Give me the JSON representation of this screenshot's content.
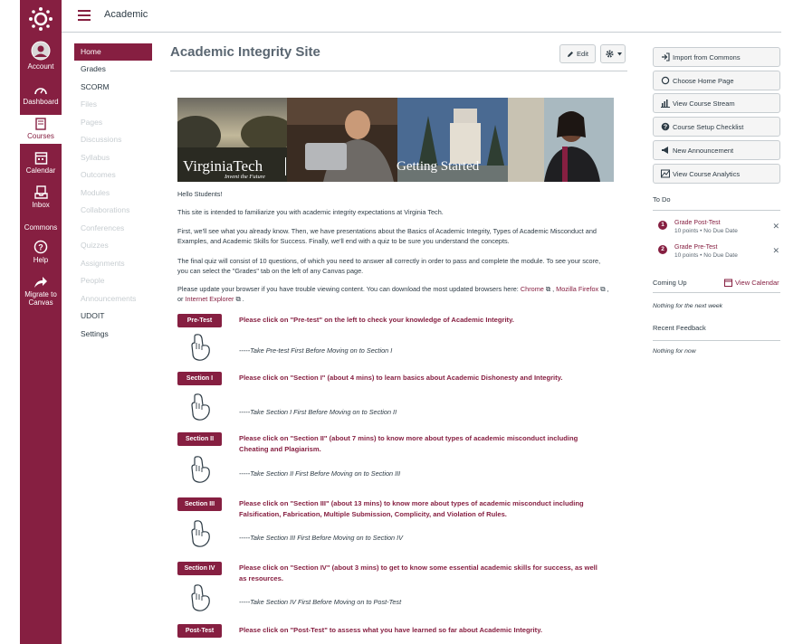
{
  "global_nav": {
    "items": [
      {
        "label": "Account",
        "icon": "account-icon"
      },
      {
        "label": "Dashboard",
        "icon": "dashboard-icon"
      },
      {
        "label": "Courses",
        "icon": "courses-icon"
      },
      {
        "label": "Calendar",
        "icon": "calendar-icon"
      },
      {
        "label": "Inbox",
        "icon": "inbox-icon"
      },
      {
        "label": "Commons",
        "icon": "commons-icon"
      },
      {
        "label": "Help",
        "icon": "help-icon"
      },
      {
        "label": "Migrate to Canvas",
        "icon": "migrate-icon"
      }
    ],
    "brand_color": "#861f41"
  },
  "header": {
    "breadcrumb": "Academic"
  },
  "course_nav": {
    "items": [
      {
        "label": "Home",
        "state": "active"
      },
      {
        "label": "Grades",
        "state": "enabled"
      },
      {
        "label": "SCORM",
        "state": "enabled"
      },
      {
        "label": "Files",
        "state": "disabled"
      },
      {
        "label": "Pages",
        "state": "disabled"
      },
      {
        "label": "Discussions",
        "state": "disabled"
      },
      {
        "label": "Syllabus",
        "state": "disabled"
      },
      {
        "label": "Outcomes",
        "state": "disabled"
      },
      {
        "label": "Modules",
        "state": "disabled"
      },
      {
        "label": "Collaborations",
        "state": "disabled"
      },
      {
        "label": "Conferences",
        "state": "disabled"
      },
      {
        "label": "Quizzes",
        "state": "disabled"
      },
      {
        "label": "Assignments",
        "state": "disabled"
      },
      {
        "label": "People",
        "state": "disabled"
      },
      {
        "label": "Announcements",
        "state": "disabled"
      },
      {
        "label": "UDOIT",
        "state": "enabled"
      },
      {
        "label": "Settings",
        "state": "enabled"
      }
    ]
  },
  "main": {
    "title": "Academic Integrity Site",
    "edit_label": "Edit",
    "banner": {
      "brand": "VirginiaTech",
      "tagline": "Invent the Future",
      "caption": "Getting Started"
    },
    "greeting": "Hello Students!",
    "intro": "This site is intended to familiarize you with academic integrity expectations at Virginia Tech.",
    "plan": "First, we'll see what you already know. Then, we have presentations about the Basics of Academic Integrity, Types of Academic Misconduct and Examples, and Academic Skills for Success. Finally, we'll end with a quiz to be sure you understand the concepts.",
    "quiz_info": "The final quiz will consist of 10 questions, of which you need to answer all correctly in order to pass and complete the module. To see your score, you can select the \"Grades\" tab on the left of any Canvas page.",
    "browser_text": "Please update your browser if you have trouble viewing content. You can download the most updated browsers here:",
    "browser_links": {
      "chrome": "Chrome",
      "firefox": "Mozilla Firefox",
      "or": ", or",
      "ie": "Internet Explorer"
    },
    "sections": [
      {
        "button": "Pre-Test",
        "text": "Please click on \"Pre-test\" on the left to check your knowledge of Academic Integrity.",
        "note": "-----Take Pre-test First Before Moving on to Section I"
      },
      {
        "button": "Section I",
        "text": "Please click on \"Section I\" (about 4 mins) to learn basics about Academic Dishonesty and Integrity.",
        "note": "-----Take Section I First Before Moving on to Section II"
      },
      {
        "button": "Section II",
        "text": "Please click on \"Section II\" (about 7 mins) to know more about types of academic misconduct including Cheating and Plagiarism.",
        "note": "-----Take Section II First Before Moving on to Section III"
      },
      {
        "button": "Section III",
        "text": "Please click on \"Section III\" (about 13 mins) to know more about types of academic misconduct including Falsification, Fabrication, Multiple Submission, Complicity, and Violation of Rules.",
        "note": "-----Take Section III First Before Moving on to Section IV"
      },
      {
        "button": "Section IV",
        "text": "Please click on \"Section IV\" (about 3 mins) to get to know some essential academic skills for success, as well as resources.",
        "note": "-----Take Section IV First Before Moving on to Post-Test"
      },
      {
        "button": "Post-Test",
        "text": "Please click on \"Post-Test\" to assess what you have learned so far about Academic Integrity.",
        "note": ""
      }
    ]
  },
  "sidebar": {
    "buttons": [
      {
        "label": "Import from Commons",
        "icon": "import-icon"
      },
      {
        "label": "Choose Home Page",
        "icon": "home-page-icon"
      },
      {
        "label": "View Course Stream",
        "icon": "stream-icon"
      },
      {
        "label": "Course Setup Checklist",
        "icon": "checklist-icon"
      },
      {
        "label": "New Announcement",
        "icon": "megaphone-icon"
      },
      {
        "label": "View Course Analytics",
        "icon": "analytics-icon"
      }
    ],
    "todo_heading": "To Do",
    "todo": [
      {
        "num": "1",
        "title": "Grade Post-Test",
        "sub": "10 points • No Due Date"
      },
      {
        "num": "2",
        "title": "Grade Pre-Test",
        "sub": "10 points • No Due Date"
      }
    ],
    "coming_up": "Coming Up",
    "view_calendar": "View Calendar",
    "coming_up_note": "Nothing for the next week",
    "feedback_heading": "Recent Feedback",
    "feedback_note": "Nothing for now"
  }
}
